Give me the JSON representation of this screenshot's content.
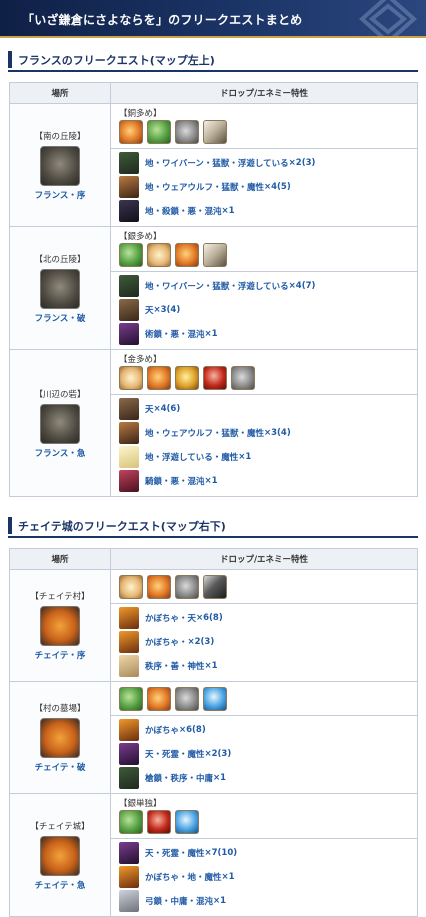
{
  "header": {
    "title": "「いざ鎌倉にさよならを」のフリークエストまとめ"
  },
  "sections": [
    {
      "title": "フランスのフリークエスト(マップ左上)",
      "col_place": "場所",
      "col_drop": "ドロップ/エネミー特性",
      "rows": [
        {
          "place": "【南の丘陵】",
          "link": "フランス・序",
          "drop_label": "【銅多め】",
          "icons": [
            "orange-seed-icon",
            "green-fang-icon",
            "gray-gear-icon",
            "feather-icon"
          ],
          "enemies": [
            {
              "text": "地・ワイバーン・猛獣・浮遊している",
              "count": "×2(3)",
              "icon": "wyvern-icon"
            },
            {
              "text": "地・ウェアウルフ・猛獣・魔性",
              "count": "×4(5)",
              "icon": "werewolf-icon"
            },
            {
              "text": "地・殺鎖・悪・混沌",
              "count": "×1",
              "icon": "assassin-icon"
            }
          ]
        },
        {
          "place": "【北の丘陵】",
          "link": "フランス・破",
          "drop_label": "【銀多め】",
          "icons": [
            "green-fang-icon",
            "bread-icon",
            "orange-seed-icon",
            "feather-icon"
          ],
          "enemies": [
            {
              "text": "地・ワイバーン・猛獣・浮遊している",
              "count": "×4(7)",
              "icon": "wyvern-icon"
            },
            {
              "text": "天",
              "count": "×3(4)",
              "icon": "sky-enemy-icon"
            },
            {
              "text": "術鎖・悪・混沌",
              "count": "×1",
              "icon": "caster-icon"
            }
          ]
        },
        {
          "place": "【川辺の砦】",
          "link": "フランス・急",
          "drop_label": "【金多め】",
          "icons": [
            "bread-icon",
            "orange-seed-icon",
            "gold-seed-icon",
            "red-seed-icon",
            "gray-gear-icon"
          ],
          "enemies": [
            {
              "text": "天",
              "count": "×4(6)",
              "icon": "sky-enemy-icon"
            },
            {
              "text": "地・ウェアウルフ・猛獣・魔性",
              "count": "×3(4)",
              "icon": "werewolf-icon"
            },
            {
              "text": "地・浮遊している・魔性",
              "count": "×1",
              "icon": "ghost-icon"
            },
            {
              "text": "騎鎖・悪・混沌",
              "count": "×1",
              "icon": "rider-icon"
            }
          ]
        }
      ]
    },
    {
      "title": "チェイテ城のフリークエスト(マップ右下)",
      "col_place": "場所",
      "col_drop": "ドロップ/エネミー特性",
      "rows": [
        {
          "place": "【チェイテ村】",
          "link": "チェイテ・序",
          "drop_label": "",
          "icons": [
            "bread-icon",
            "orange-seed-icon",
            "gray-gear-icon",
            "dark-horn-icon"
          ],
          "enemies": [
            {
              "text": "かぼちゃ・天",
              "count": "×6(8)",
              "icon": "pumpkin-icon"
            },
            {
              "text": "かぼちゃ・",
              "count": "×2(3)",
              "icon": "pumpkin-icon"
            },
            {
              "text": "秩序・善・神性",
              "count": "×1",
              "icon": "blonde-icon"
            }
          ]
        },
        {
          "place": "【村の墓場】",
          "link": "チェイテ・破",
          "drop_label": "",
          "icons": [
            "green-fang-icon",
            "orange-seed-icon",
            "gray-gear-icon",
            "blue-gem-icon"
          ],
          "enemies": [
            {
              "text": "かぼちゃ",
              "count": "×6(8)",
              "icon": "pumpkin-icon"
            },
            {
              "text": "天・死霊・魔性",
              "count": "×2(3)",
              "icon": "purple-icon"
            },
            {
              "text": "槍鎖・秩序・中庸",
              "count": "×1",
              "icon": "lancer-icon"
            }
          ]
        },
        {
          "place": "【チェイテ城】",
          "link": "チェイテ・急",
          "drop_label": "【銀単独】",
          "icons": [
            "green-fang-icon",
            "red-seed-icon",
            "blue-gem-icon"
          ],
          "enemies": [
            {
              "text": "天・死霊・魔性",
              "count": "×7(10)",
              "icon": "purple-icon"
            },
            {
              "text": "かぼちゃ・地・魔性",
              "count": "×1",
              "icon": "pumpkin-icon"
            },
            {
              "text": "弓鎖・中庸・混沌",
              "count": "×1",
              "icon": "archer-icon"
            }
          ]
        }
      ]
    }
  ]
}
